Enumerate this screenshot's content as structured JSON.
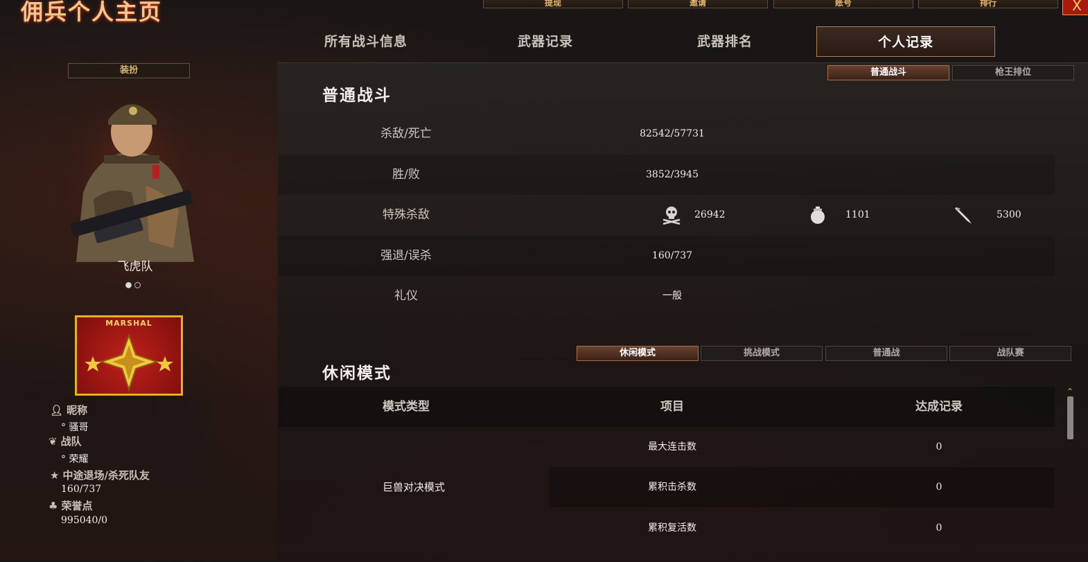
{
  "header": {
    "title": "佣兵个人主页",
    "top_buttons": [
      "提现",
      "邀请",
      "账号",
      "排行"
    ],
    "close_label": "X"
  },
  "main_tabs": [
    {
      "label": "所有战斗信息",
      "active": false
    },
    {
      "label": "武器记录",
      "active": false
    },
    {
      "label": "武器排名",
      "active": false
    },
    {
      "label": "个人记录",
      "active": true
    }
  ],
  "sidebar": {
    "skin_button": "装扮",
    "character_name": "飞虎队",
    "carousel": {
      "total": 2,
      "current": 1
    },
    "rank": {
      "label": "MARSHAL",
      "colors": {
        "frame": "#e2b320",
        "fill": "#b51d16"
      }
    },
    "info": {
      "nickname_label": "昵称",
      "nickname_value": "° 骚哥",
      "clan_label": "战队",
      "clan_value": "° 荣耀",
      "quit_label": "中途退场/杀死队友",
      "quit_value": "160/737",
      "honor_label": "荣誉点",
      "honor_value": "995040/0"
    },
    "icons": [
      "person-icon",
      "clan-icon",
      "runner-icon",
      "leaf-icon"
    ]
  },
  "normal_battle": {
    "title": "普通战斗",
    "sub_tabs": [
      {
        "label": "普通战斗",
        "active": true
      },
      {
        "label": "枪王排位",
        "active": false
      }
    ],
    "rows": [
      {
        "label": "杀敌/死亡",
        "value": "82542/57731"
      },
      {
        "label": "胜/败",
        "value": "3852/3945"
      },
      {
        "label": "特殊杀敌",
        "value": ""
      },
      {
        "label": "强退/误杀",
        "value": "160/737"
      },
      {
        "label": "礼仪",
        "value": "一般"
      }
    ],
    "special_kills": [
      {
        "icon": "skull-icon",
        "value": "26942"
      },
      {
        "icon": "grenade-icon",
        "value": "1101"
      },
      {
        "icon": "knife-icon",
        "value": "5300"
      }
    ]
  },
  "casual_mode": {
    "title": "休闲模式",
    "sub_tabs": [
      {
        "label": "休闲模式",
        "active": true
      },
      {
        "label": "挑战模式",
        "active": false
      },
      {
        "label": "普通战",
        "active": false
      },
      {
        "label": "战队赛",
        "active": false
      }
    ],
    "columns": [
      "模式类型",
      "项目",
      "达成记录"
    ],
    "group": "巨兽对决模式",
    "rows": [
      {
        "item": "最大连击数",
        "value": "0"
      },
      {
        "item": "累积击杀数",
        "value": "0"
      },
      {
        "item": "累积复活数",
        "value": "0"
      }
    ]
  }
}
